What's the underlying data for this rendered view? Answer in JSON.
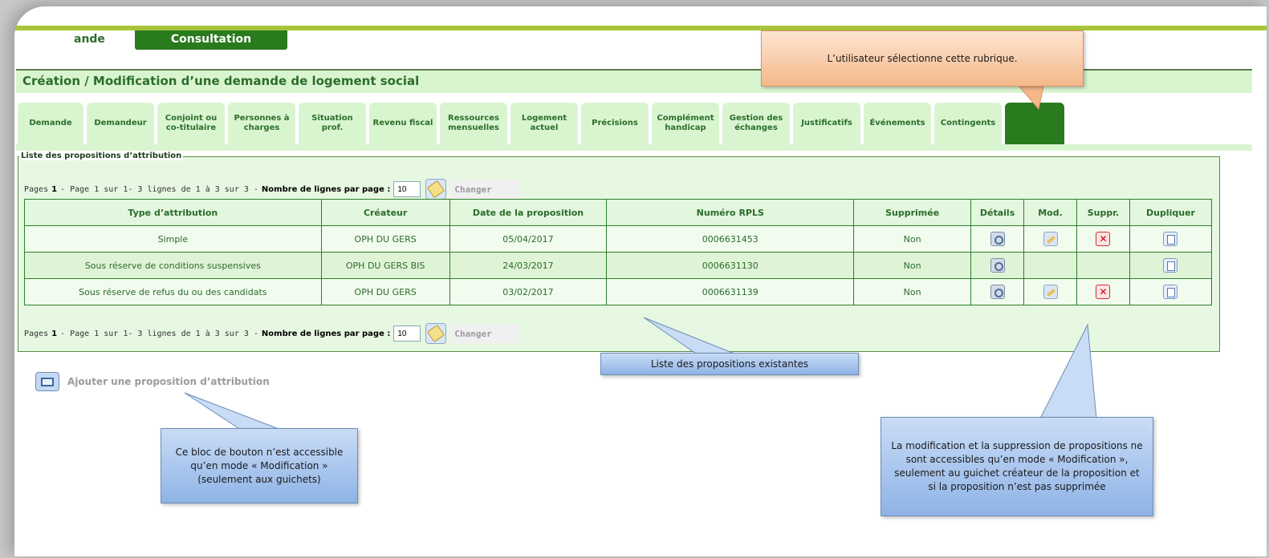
{
  "header": {
    "tab_demande": "ande",
    "tab_consultation": "Consultation",
    "page_title": "Création / Modification d’une demande de logement social"
  },
  "subtabs": [
    {
      "label": "Demande",
      "width": 82
    },
    {
      "label": "Demandeur",
      "width": 84
    },
    {
      "label": "Conjoint ou co-titulaire",
      "width": 84
    },
    {
      "label": "Personnes à charges",
      "width": 84
    },
    {
      "label": "Situation prof.",
      "width": 84
    },
    {
      "label": "Revenu fiscal",
      "width": 84
    },
    {
      "label": "Ressources mensuelles",
      "width": 84
    },
    {
      "label": "Logement actuel",
      "width": 84
    },
    {
      "label": "Précisions",
      "width": 84
    },
    {
      "label": "Complément handicap",
      "width": 84
    },
    {
      "label": "Gestion des échanges",
      "width": 84
    },
    {
      "label": "Justificatifs",
      "width": 84
    },
    {
      "label": "Événements",
      "width": 84
    },
    {
      "label": "Contingents",
      "width": 84
    },
    {
      "label": "",
      "width": 74,
      "active": true
    }
  ],
  "list": {
    "legend": "Liste des propositions d’attribution",
    "pager": {
      "pages_label": "Pages",
      "current_page": "1",
      "page_info": "- Page 1 sur 1- 3 lignes de 1 à 3 sur 3 -",
      "lines_per_page_label": "Nombre de lignes par page :",
      "lines_per_page_value": "10",
      "change_label": "Changer"
    },
    "columns": [
      "Type d’attribution",
      "Créateur",
      "Date de la proposition",
      "Numéro RPLS",
      "Supprimée",
      "Détails",
      "Mod.",
      "Suppr.",
      "Dupliquer"
    ],
    "rows": [
      {
        "type": "Simple",
        "createur": "OPH DU GERS",
        "date": "05/04/2017",
        "rpls": "0006631453",
        "supprimee": "Non",
        "mod": true,
        "suppr": true
      },
      {
        "type": "Sous réserve de conditions suspensives",
        "createur": "OPH DU GERS BIS",
        "date": "24/03/2017",
        "rpls": "0006631130",
        "supprimee": "Non",
        "mod": false,
        "suppr": false
      },
      {
        "type": "Sous réserve de refus du ou des candidats",
        "createur": "OPH DU GERS",
        "date": "03/02/2017",
        "rpls": "0006631139",
        "supprimee": "Non",
        "mod": true,
        "suppr": true
      }
    ]
  },
  "add_button_label": "Ajouter une proposition d’attribution",
  "callouts": {
    "rubrique": "L’utilisateur sélectionne cette rubrique.",
    "liste": "Liste des propositions existantes",
    "bloc": "Ce bloc de bouton n’est accessible qu’en mode « Modification » (seulement aux guichets)",
    "modif": "La modification et la suppression de propositions ne sont accessibles qu’en mode « Modification », seulement au guichet créateur de la proposition et si la proposition n’est pas supprimée"
  }
}
